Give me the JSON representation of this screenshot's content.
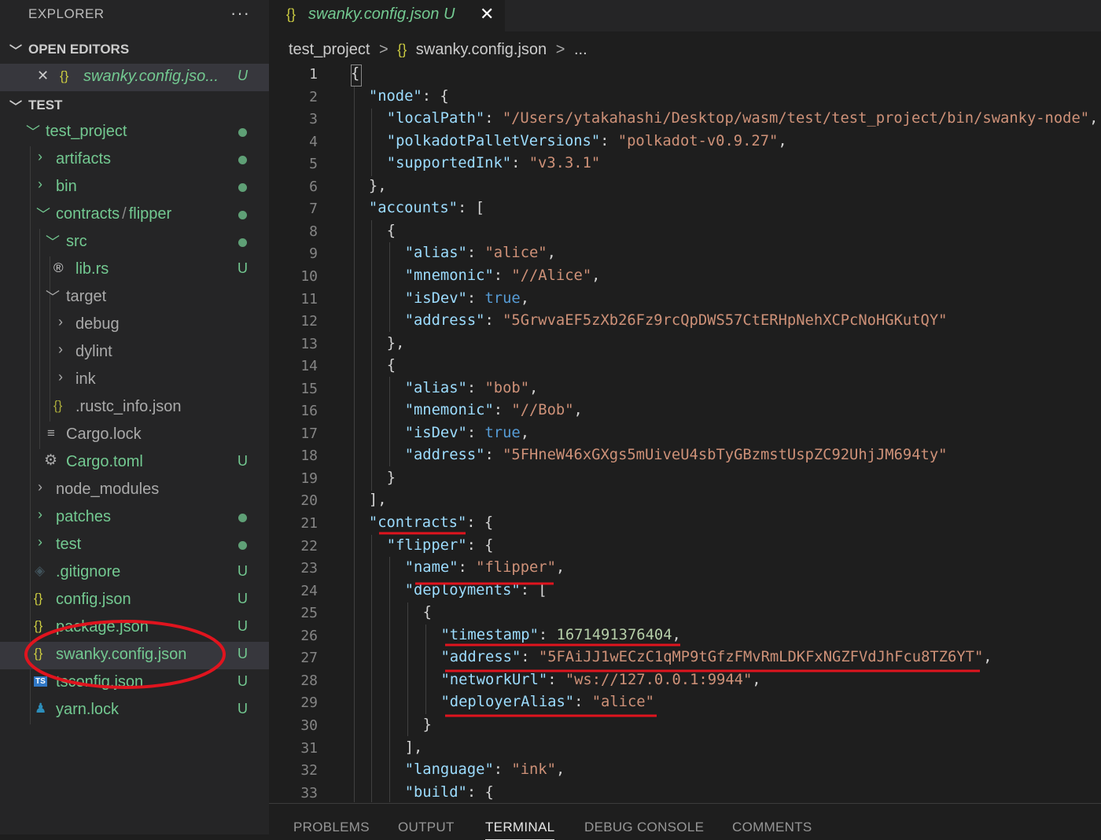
{
  "sidebar": {
    "title": "EXPLORER",
    "more": "···",
    "open_editors": {
      "label": "OPEN EDITORS",
      "item": {
        "close": "✕",
        "icon": "{}",
        "label": "swanky.config.jso...",
        "badge": "U"
      }
    },
    "workspace": {
      "label": "TEST"
    },
    "tree": [
      {
        "label": "test_project",
        "status": "dot"
      },
      {
        "label": "artifacts",
        "status": "dot"
      },
      {
        "label": "bin",
        "status": "dot"
      },
      {
        "label": "contracts",
        "label2": "flipper",
        "status": "dot"
      },
      {
        "label": "src",
        "status": "dot"
      },
      {
        "label": "lib.rs",
        "icon": "®",
        "badge": "U"
      },
      {
        "label": "target"
      },
      {
        "label": "debug"
      },
      {
        "label": "dylint"
      },
      {
        "label": "ink"
      },
      {
        "label": ".rustc_info.json",
        "icon": "{}"
      },
      {
        "label": "Cargo.lock",
        "icon": "≡"
      },
      {
        "label": "Cargo.toml",
        "icon": "⚙",
        "badge": "U"
      },
      {
        "label": "node_modules"
      },
      {
        "label": "patches",
        "status": "dot"
      },
      {
        "label": "test",
        "status": "dot"
      },
      {
        "label": ".gitignore",
        "icon": "◈",
        "badge": "U"
      },
      {
        "label": "config.json",
        "icon": "{}",
        "badge": "U"
      },
      {
        "label": "package.json",
        "icon": "{}",
        "badge": "U"
      },
      {
        "label": "swanky.config.json",
        "icon": "{}",
        "badge": "U"
      },
      {
        "label": "tsconfig.json",
        "icon": "TS",
        "badge": "U"
      },
      {
        "label": "yarn.lock",
        "icon": "♟",
        "badge": "U"
      }
    ]
  },
  "editor": {
    "tab": {
      "icon": "{}",
      "label": "swanky.config.json",
      "badge": "U",
      "close": "✕"
    },
    "breadcrumbs": [
      "test_project",
      ">",
      "{}",
      "swanky.config.json",
      ">",
      "..."
    ],
    "line_numbers": [
      "1",
      "2",
      "3",
      "4",
      "5",
      "6",
      "7",
      "8",
      "9",
      "10",
      "11",
      "12",
      "13",
      "14",
      "15",
      "16",
      "17",
      "18",
      "19",
      "20",
      "21",
      "22",
      "23",
      "24",
      "25",
      "26",
      "27",
      "28",
      "29",
      "30",
      "31",
      "32",
      "33"
    ],
    "lines": [
      {
        "indent": 0,
        "tokens": [
          [
            "p",
            "{"
          ]
        ]
      },
      {
        "indent": 1,
        "tokens": [
          [
            "k",
            "\"node\""
          ],
          [
            "p",
            ": {"
          ]
        ]
      },
      {
        "indent": 2,
        "tokens": [
          [
            "k",
            "\"localPath\""
          ],
          [
            "p",
            ": "
          ],
          [
            "s",
            "\"/Users/ytakahashi/Desktop/wasm/test/test_project/bin/swanky-node\""
          ],
          [
            "p",
            ","
          ]
        ]
      },
      {
        "indent": 2,
        "tokens": [
          [
            "k",
            "\"polkadotPalletVersions\""
          ],
          [
            "p",
            ": "
          ],
          [
            "s",
            "\"polkadot-v0.9.27\""
          ],
          [
            "p",
            ","
          ]
        ]
      },
      {
        "indent": 2,
        "tokens": [
          [
            "k",
            "\"supportedInk\""
          ],
          [
            "p",
            ": "
          ],
          [
            "s",
            "\"v3.3.1\""
          ]
        ]
      },
      {
        "indent": 1,
        "tokens": [
          [
            "p",
            "},"
          ]
        ]
      },
      {
        "indent": 1,
        "tokens": [
          [
            "k",
            "\"accounts\""
          ],
          [
            "p",
            ": ["
          ]
        ]
      },
      {
        "indent": 2,
        "tokens": [
          [
            "p",
            "{"
          ]
        ]
      },
      {
        "indent": 3,
        "tokens": [
          [
            "k",
            "\"alias\""
          ],
          [
            "p",
            ": "
          ],
          [
            "s",
            "\"alice\""
          ],
          [
            "p",
            ","
          ]
        ]
      },
      {
        "indent": 3,
        "tokens": [
          [
            "k",
            "\"mnemonic\""
          ],
          [
            "p",
            ": "
          ],
          [
            "s",
            "\"//Alice\""
          ],
          [
            "p",
            ","
          ]
        ]
      },
      {
        "indent": 3,
        "tokens": [
          [
            "k",
            "\"isDev\""
          ],
          [
            "p",
            ": "
          ],
          [
            "b",
            "true"
          ],
          [
            "p",
            ","
          ]
        ]
      },
      {
        "indent": 3,
        "tokens": [
          [
            "k",
            "\"address\""
          ],
          [
            "p",
            ": "
          ],
          [
            "s",
            "\"5GrwvaEF5zXb26Fz9rcQpDWS57CtERHpNehXCPcNoHGKutQY\""
          ]
        ]
      },
      {
        "indent": 2,
        "tokens": [
          [
            "p",
            "},"
          ]
        ]
      },
      {
        "indent": 2,
        "tokens": [
          [
            "p",
            "{"
          ]
        ]
      },
      {
        "indent": 3,
        "tokens": [
          [
            "k",
            "\"alias\""
          ],
          [
            "p",
            ": "
          ],
          [
            "s",
            "\"bob\""
          ],
          [
            "p",
            ","
          ]
        ]
      },
      {
        "indent": 3,
        "tokens": [
          [
            "k",
            "\"mnemonic\""
          ],
          [
            "p",
            ": "
          ],
          [
            "s",
            "\"//Bob\""
          ],
          [
            "p",
            ","
          ]
        ]
      },
      {
        "indent": 3,
        "tokens": [
          [
            "k",
            "\"isDev\""
          ],
          [
            "p",
            ": "
          ],
          [
            "b",
            "true"
          ],
          [
            "p",
            ","
          ]
        ]
      },
      {
        "indent": 3,
        "tokens": [
          [
            "k",
            "\"address\""
          ],
          [
            "p",
            ": "
          ],
          [
            "s",
            "\"5FHneW46xGXgs5mUiveU4sbTyGBzmstUspZC92UhjJM694ty\""
          ]
        ]
      },
      {
        "indent": 2,
        "tokens": [
          [
            "p",
            "}"
          ]
        ]
      },
      {
        "indent": 1,
        "tokens": [
          [
            "p",
            "],"
          ]
        ]
      },
      {
        "indent": 1,
        "tokens": [
          [
            "k",
            "\"contracts\""
          ],
          [
            "p",
            ": {"
          ]
        ]
      },
      {
        "indent": 2,
        "tokens": [
          [
            "k",
            "\"flipper\""
          ],
          [
            "p",
            ": {"
          ]
        ]
      },
      {
        "indent": 3,
        "tokens": [
          [
            "k",
            "\"name\""
          ],
          [
            "p",
            ": "
          ],
          [
            "s",
            "\"flipper\""
          ],
          [
            "p",
            ","
          ]
        ]
      },
      {
        "indent": 3,
        "tokens": [
          [
            "k",
            "\"deployments\""
          ],
          [
            "p",
            ": ["
          ]
        ]
      },
      {
        "indent": 4,
        "tokens": [
          [
            "p",
            "{"
          ]
        ]
      },
      {
        "indent": 5,
        "tokens": [
          [
            "k",
            "\"timestamp\""
          ],
          [
            "p",
            ": "
          ],
          [
            "n",
            "1671491376404"
          ],
          [
            "p",
            ","
          ]
        ]
      },
      {
        "indent": 5,
        "tokens": [
          [
            "k",
            "\"address\""
          ],
          [
            "p",
            ": "
          ],
          [
            "s",
            "\"5FAiJJ1wECzC1qMP9tGfzFMvRmLDKFxNGZFVdJhFcu8TZ6YT\""
          ],
          [
            "p",
            ","
          ]
        ]
      },
      {
        "indent": 5,
        "tokens": [
          [
            "k",
            "\"networkUrl\""
          ],
          [
            "p",
            ": "
          ],
          [
            "s",
            "\"ws://127.0.0.1:9944\""
          ],
          [
            "p",
            ","
          ]
        ]
      },
      {
        "indent": 5,
        "tokens": [
          [
            "k",
            "\"deployerAlias\""
          ],
          [
            "p",
            ": "
          ],
          [
            "s",
            "\"alice\""
          ]
        ]
      },
      {
        "indent": 4,
        "tokens": [
          [
            "p",
            "}"
          ]
        ]
      },
      {
        "indent": 3,
        "tokens": [
          [
            "p",
            "],"
          ]
        ]
      },
      {
        "indent": 3,
        "tokens": [
          [
            "k",
            "\"language\""
          ],
          [
            "p",
            ": "
          ],
          [
            "s",
            "\"ink\""
          ],
          [
            "p",
            ","
          ]
        ]
      },
      {
        "indent": 3,
        "tokens": [
          [
            "k",
            "\"build\""
          ],
          [
            "p",
            ": {"
          ]
        ]
      }
    ]
  },
  "panel": {
    "tabs": [
      "PROBLEMS",
      "OUTPUT",
      "TERMINAL",
      "DEBUG CONSOLE",
      "COMMENTS"
    ],
    "active": "TERMINAL"
  },
  "colors": {
    "annotation": "#e0141e",
    "git_untracked": "#73c991",
    "json_icon": "#cbcb41"
  }
}
